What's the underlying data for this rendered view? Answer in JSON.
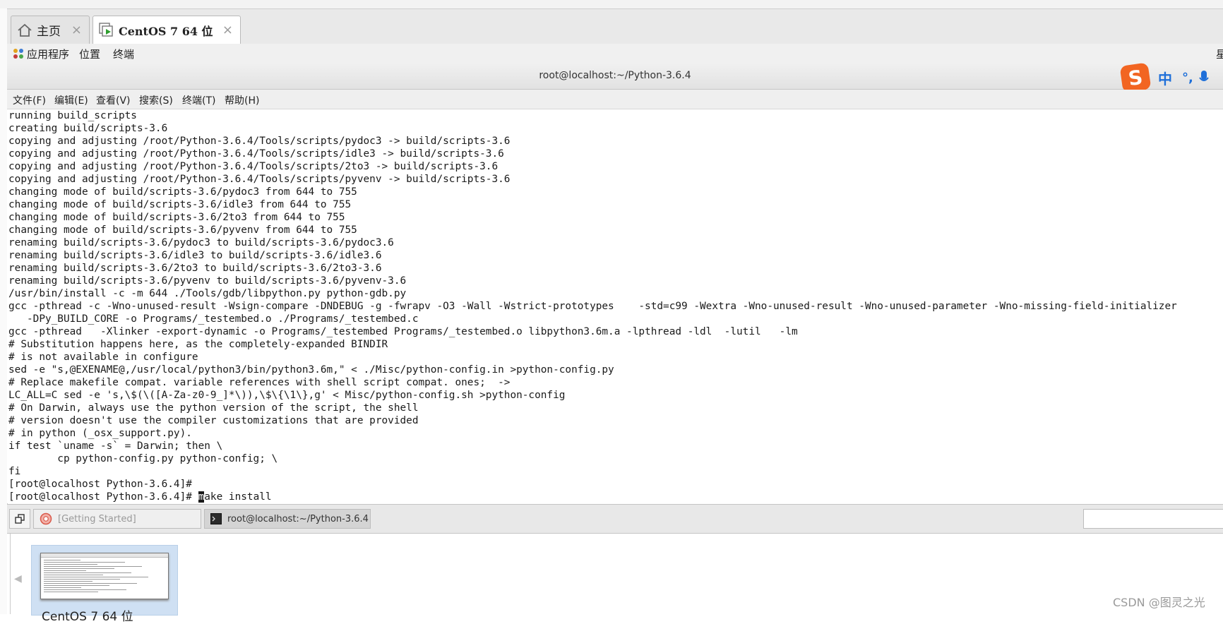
{
  "tabs": [
    {
      "label": "主页",
      "icon": "home-icon",
      "close": "×"
    },
    {
      "label": "CentOS 7 64 位",
      "icon": "vm-icon",
      "close": "×"
    }
  ],
  "gnome_menu": {
    "applications": "应用程序",
    "places": "位置",
    "terminal": "终端",
    "right_clipped": "星"
  },
  "window": {
    "title": "root@localhost:~/Python-3.6.4"
  },
  "ime": {
    "logo": "S",
    "mode": "中",
    "punct": "°,",
    "mic": "mic-icon"
  },
  "menu": [
    "文件(F)",
    "编辑(E)",
    "查看(V)",
    "搜索(S)",
    "终端(T)",
    "帮助(H)"
  ],
  "terminal": {
    "lines": [
      "running build_scripts",
      "creating build/scripts-3.6",
      "copying and adjusting /root/Python-3.6.4/Tools/scripts/pydoc3 -> build/scripts-3.6",
      "copying and adjusting /root/Python-3.6.4/Tools/scripts/idle3 -> build/scripts-3.6",
      "copying and adjusting /root/Python-3.6.4/Tools/scripts/2to3 -> build/scripts-3.6",
      "copying and adjusting /root/Python-3.6.4/Tools/scripts/pyvenv -> build/scripts-3.6",
      "changing mode of build/scripts-3.6/pydoc3 from 644 to 755",
      "changing mode of build/scripts-3.6/idle3 from 644 to 755",
      "changing mode of build/scripts-3.6/2to3 from 644 to 755",
      "changing mode of build/scripts-3.6/pyvenv from 644 to 755",
      "renaming build/scripts-3.6/pydoc3 to build/scripts-3.6/pydoc3.6",
      "renaming build/scripts-3.6/idle3 to build/scripts-3.6/idle3.6",
      "renaming build/scripts-3.6/2to3 to build/scripts-3.6/2to3-3.6",
      "renaming build/scripts-3.6/pyvenv to build/scripts-3.6/pyvenv-3.6",
      "/usr/bin/install -c -m 644 ./Tools/gdb/libpython.py python-gdb.py",
      "gcc -pthread -c -Wno-unused-result -Wsign-compare -DNDEBUG -g -fwrapv -O3 -Wall -Wstrict-prototypes    -std=c99 -Wextra -Wno-unused-result -Wno-unused-parameter -Wno-missing-field-initializer",
      "   -DPy_BUILD_CORE -o Programs/_testembed.o ./Programs/_testembed.c",
      "gcc -pthread   -Xlinker -export-dynamic -o Programs/_testembed Programs/_testembed.o libpython3.6m.a -lpthread -ldl  -lutil   -lm",
      "# Substitution happens here, as the completely-expanded BINDIR",
      "# is not available in configure",
      "sed -e \"s,@EXENAME@,/usr/local/python3/bin/python3.6m,\" < ./Misc/python-config.in >python-config.py",
      "# Replace makefile compat. variable references with shell script compat. ones;  ->",
      "LC_ALL=C sed -e 's,\\$(\\([A-Za-z0-9_]*\\)),\\$\\{\\1\\},g' < Misc/python-config.sh >python-config",
      "# On Darwin, always use the python version of the script, the shell",
      "# version doesn't use the compiler customizations that are provided",
      "# in python (_osx_support.py).",
      "if test `uname -s` = Darwin; then \\",
      "        cp python-config.py python-config; \\",
      "fi",
      "[root@localhost Python-3.6.4]#"
    ],
    "prompt": "[root@localhost Python-3.6.4]# ",
    "cursor_char": "m",
    "command_rest": "ake install"
  },
  "taskbar": {
    "getting_started": "[Getting Started]",
    "terminal_item": "root@localhost:~/Python-3.6.4"
  },
  "thumbnail": {
    "label": "CentOS 7 64 位",
    "arrow": "◀"
  },
  "watermark": "CSDN @图灵之光"
}
